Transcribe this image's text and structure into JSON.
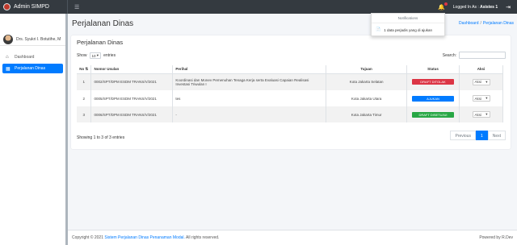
{
  "navbar": {
    "brand": "Admin SIMPD",
    "menu_icon": "hamburger-icon",
    "logged_prefix": "Logged In As :",
    "logged_user": "Asistes 1"
  },
  "sidebar": {
    "user_name": "Drs. Syukri I. Botutihe, M",
    "items": [
      {
        "label": "Dashboard",
        "icon": "home-icon",
        "active": false
      },
      {
        "label": "Perjalanan Dinas",
        "icon": "map-icon",
        "active": true
      }
    ]
  },
  "header": {
    "title": "Perjalanan Dinas",
    "breadcrumb": [
      "Dashboard",
      "Perjalanan Dinas"
    ]
  },
  "card": {
    "title": "Perjalanan Dinas",
    "show_label": "Show",
    "entries_value": "10",
    "entries_label": "entries",
    "search_label": "Search:",
    "search_value": ""
  },
  "table": {
    "headers": [
      "No",
      "Nomor Usulan",
      "Perihal",
      "Tujuan",
      "Status",
      "Aksi"
    ],
    "rows": [
      {
        "no": "1",
        "nomor": "0002/SPT/DPM ESDM TRANS/V/2021",
        "perihal": "Koordinasi dan Monev Pemenuhan Tenaga Kerja serta Evaluasi Capaian Realisasi Investasi Triwulan I",
        "tujuan": "Kota Jakarta Selatan",
        "status": "DRAFT DITOLAK",
        "status_color": "#dc3545",
        "aksi": "Aksi"
      },
      {
        "no": "2",
        "nomor": "0005/SPT/DPM ESDM TRANS/V/2021",
        "perihal": "tes",
        "tujuan": "Kota Jakarta Utara",
        "status": "AJUKAN",
        "status_color": "#007bff",
        "aksi": "Aksi"
      },
      {
        "no": "3",
        "nomor": "0006/SPT/DPM ESDM TRANS/V/2021",
        "perihal": "-",
        "tujuan": "Kota Jakarta Timur",
        "status": "DRAFT DISETUJUI",
        "status_color": "#28a745",
        "aksi": "Aksi"
      }
    ]
  },
  "info": "Showing 1 to 3 of 3 entries",
  "pagination": {
    "previous": "Previous",
    "current": "1",
    "next": "Next"
  },
  "notifications": {
    "header": "Notifications",
    "item": "1 data perjadis yang di ajukan"
  },
  "footer": {
    "prefix": "Copyright © 2021",
    "link": "Sistem Perjalanan Dinas Penanaman Modal.",
    "suffix": "All rights reserved.",
    "powered": "Powered by R.Dev"
  }
}
